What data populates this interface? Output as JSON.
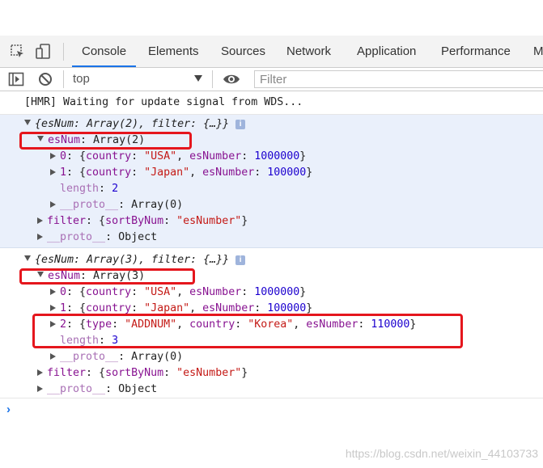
{
  "tabs": [
    "Console",
    "Elements",
    "Sources",
    "Network",
    "Application",
    "Performance",
    "M"
  ],
  "active_tab": "Console",
  "toolbar": {
    "context": "top",
    "filter_placeholder": "Filter"
  },
  "messages": {
    "hmr": "[HMR] Waiting for update signal from WDS...",
    "obj1": {
      "summary": "{esNum: Array(2), filter: {…}}",
      "esNum_key": "esNum",
      "esNum_val": ": Array(2)",
      "items": [
        {
          "idx": "0",
          "country": "\"USA\"",
          "esNumber": "1000000"
        },
        {
          "idx": "1",
          "country": "\"Japan\"",
          "esNumber": "100000"
        }
      ],
      "length_key": "length",
      "length_val": "2",
      "proto_key": "__proto__",
      "proto_arr": ": Array(0)",
      "filter_key": "filter",
      "filter_sortByNum": "\"esNumber\"",
      "proto_obj": ": Object"
    },
    "obj2": {
      "summary": "{esNum: Array(3), filter: {…}}",
      "esNum_key": "esNum",
      "esNum_val": ": Array(3)",
      "items": [
        {
          "idx": "0",
          "country": "\"USA\"",
          "esNumber": "1000000"
        },
        {
          "idx": "1",
          "country": "\"Japan\"",
          "esNumber": "100000"
        }
      ],
      "item2": {
        "idx": "2",
        "type": "\"ADDNUM\"",
        "country": "\"Korea\"",
        "esNumber": "110000"
      },
      "length_key": "length",
      "length_val": "3",
      "proto_key": "__proto__",
      "proto_arr": ": Array(0)",
      "filter_key": "filter",
      "filter_sortByNum": "\"esNumber\"",
      "proto_obj": ": Object"
    }
  },
  "labels": {
    "country": "country",
    "esNumber": "esNumber",
    "type": "type",
    "sortByNum": "sortByNum"
  },
  "prompt": "›",
  "watermark": "https://blog.csdn.net/weixin_44103733",
  "colors": {
    "highlight_box": "#e5161d",
    "active_tab_underline": "#1a73e8",
    "object_row_bg": "#eaf0fb"
  }
}
